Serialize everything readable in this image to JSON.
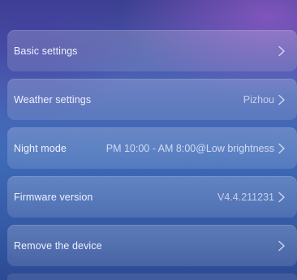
{
  "settings": {
    "items": [
      {
        "label": "Basic settings",
        "value": ""
      },
      {
        "label": "Weather settings",
        "value": "Pizhou"
      },
      {
        "label": "Night mode",
        "value": "PM 10:00 - AM 8:00@Low brightness"
      },
      {
        "label": "Firmware version",
        "value": "V4.4.211231"
      },
      {
        "label": "Remove the device",
        "value": ""
      }
    ]
  },
  "icons": {
    "chevron": "chevron-right-icon"
  }
}
